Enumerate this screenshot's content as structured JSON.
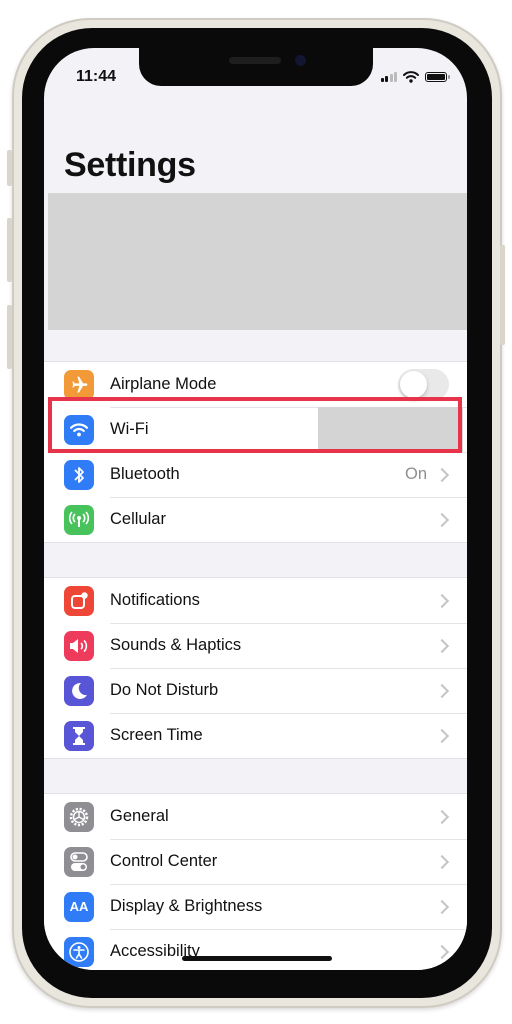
{
  "status_bar": {
    "time": "11:44",
    "signal_bars": 2,
    "signal_total": 4,
    "wifi": true,
    "battery": "full"
  },
  "header": {
    "title": "Settings"
  },
  "profile": {
    "redacted": true
  },
  "groups": [
    {
      "items": [
        {
          "label": "Airplane Mode",
          "icon": "airplane-icon",
          "color": "#f19a37",
          "control": "toggle",
          "toggle_on": false
        },
        {
          "label": "Wi-Fi",
          "icon": "wifi-icon",
          "color": "#2f7cf6",
          "control": "redacted",
          "highlighted": true
        },
        {
          "label": "Bluetooth",
          "icon": "bluetooth-icon",
          "color": "#2f7cf6",
          "value": "On",
          "control": "chevron"
        },
        {
          "label": "Cellular",
          "icon": "cellular-icon",
          "color": "#48c35b",
          "control": "chevron"
        }
      ]
    },
    {
      "items": [
        {
          "label": "Notifications",
          "icon": "notifications-icon",
          "color": "#ee4637",
          "control": "chevron"
        },
        {
          "label": "Sounds & Haptics",
          "icon": "speaker-icon",
          "color": "#ee3b5c",
          "control": "chevron"
        },
        {
          "label": "Do Not Disturb",
          "icon": "moon-icon",
          "color": "#5856d6",
          "control": "chevron"
        },
        {
          "label": "Screen Time",
          "icon": "hourglass-icon",
          "color": "#5856d6",
          "control": "chevron"
        }
      ]
    },
    {
      "items": [
        {
          "label": "General",
          "icon": "gear-icon",
          "color": "#8e8e93",
          "control": "chevron"
        },
        {
          "label": "Control Center",
          "icon": "switches-icon",
          "color": "#8e8e93",
          "control": "chevron"
        },
        {
          "label": "Display & Brightness",
          "icon": "text-size-icon",
          "color": "#2f7cf6",
          "control": "chevron",
          "icon_text": "AA"
        },
        {
          "label": "Accessibility",
          "icon": "accessibility-icon",
          "color": "#2f7cf6",
          "control": "chevron"
        }
      ]
    }
  ],
  "annotation": {
    "highlight_color": "#e8344a",
    "target": "Wi-Fi"
  }
}
